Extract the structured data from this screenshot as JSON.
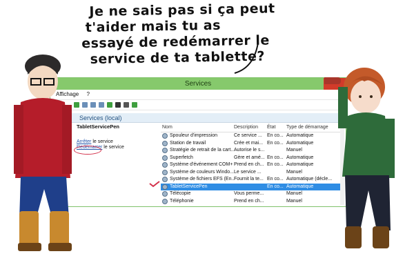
{
  "speech": {
    "lines": [
      "Je ne sais pas si ça peut",
      "t'aider mais tu as",
      "essayé de redémarrer le",
      "service de ta tablette?"
    ]
  },
  "window": {
    "title": "Services",
    "menu": [
      "Affichage",
      "?"
    ],
    "panel_title": "Services (local)",
    "selected_service": "TabletServicePen",
    "actions": {
      "stop_link": "Arrêter",
      "stop_rest": " le service",
      "restart_link": "Redémarrer",
      "restart_rest": " le service"
    },
    "columns": {
      "name": "Nom",
      "description": "Description",
      "state": "État",
      "startup": "Type de démarrage"
    },
    "rows": [
      {
        "name": "Spouleur d'impression",
        "description": "Ce service ...",
        "state": "En co...",
        "startup": "Automatique"
      },
      {
        "name": "Station de travail",
        "description": "Crée et mai...",
        "state": "En co...",
        "startup": "Automatique"
      },
      {
        "name": "Stratégie de retrait de la cart...",
        "description": "Autorise le s...",
        "state": "",
        "startup": "Manuel"
      },
      {
        "name": "Superfetch",
        "description": "Gère et amé...",
        "state": "En co...",
        "startup": "Automatique"
      },
      {
        "name": "Système d'événement COM+",
        "description": "Prend en ch...",
        "state": "En co...",
        "startup": "Automatique"
      },
      {
        "name": "Système de couleurs Windo...",
        "description": "Le service ...",
        "state": "",
        "startup": "Manuel"
      },
      {
        "name": "Système de fichiers EFS (En...",
        "description": "Fournit la te...",
        "state": "En co...",
        "startup": "Automatique (décle..."
      },
      {
        "name": "TabletServicePen",
        "description": "",
        "state": "En co...",
        "startup": "Automatique",
        "selected": true
      },
      {
        "name": "Télécopie",
        "description": "Vous perme...",
        "state": "",
        "startup": "Manuel"
      },
      {
        "name": "Téléphonie",
        "description": "Prend en ch...",
        "state": "",
        "startup": "Manuel"
      }
    ]
  },
  "colors": {
    "titlebar": "#86c96c",
    "selection": "#2f8de4",
    "highlight_circle": "#d3304a"
  },
  "icons": [
    "gear-icon",
    "close-icon",
    "minimize-icon",
    "maximize-icon",
    "back-icon",
    "forward-icon",
    "play-icon",
    "stop-icon",
    "pause-icon",
    "restart-icon",
    "checkmark-icon"
  ]
}
